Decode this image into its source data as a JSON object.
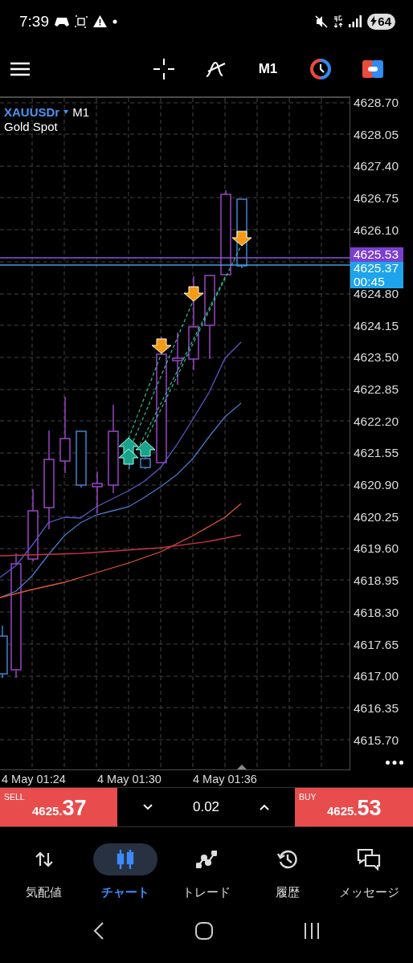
{
  "status_bar": {
    "time": "7:39",
    "battery": "64"
  },
  "toolbar": {
    "timeframe": "M1"
  },
  "chart": {
    "symbol": "XAUUSDr",
    "timeframe": "M1",
    "description": "Gold Spot",
    "price_axis": [
      {
        "kind": "tick",
        "label": "4628.70"
      },
      {
        "kind": "tick",
        "label": "4628.05"
      },
      {
        "kind": "tick",
        "label": "4627.40"
      },
      {
        "kind": "tick",
        "label": "4626.75"
      },
      {
        "kind": "tick",
        "label": "4626.10"
      },
      {
        "kind": "quote",
        "ask": "4625.53",
        "bid": "4625.37",
        "countdown": "00:45"
      },
      {
        "kind": "tick",
        "label": "4624.80"
      },
      {
        "kind": "tick",
        "label": "4624.15"
      },
      {
        "kind": "tick",
        "label": "4623.50"
      },
      {
        "kind": "tick",
        "label": "4622.85"
      },
      {
        "kind": "tick",
        "label": "4622.20"
      },
      {
        "kind": "tick",
        "label": "4621.55"
      },
      {
        "kind": "tick",
        "label": "4620.90"
      },
      {
        "kind": "tick",
        "label": "4620.25"
      },
      {
        "kind": "tick",
        "label": "4619.60"
      },
      {
        "kind": "tick",
        "label": "4618.95"
      },
      {
        "kind": "tick",
        "label": "4618.30"
      },
      {
        "kind": "tick",
        "label": "4617.65"
      },
      {
        "kind": "tick",
        "label": "4617.00"
      },
      {
        "kind": "tick",
        "label": "4616.35"
      },
      {
        "kind": "tick",
        "label": "4615.70"
      }
    ],
    "time_labels": [
      "4 May 01:24",
      "4 May 01:30",
      "4 May 01:36"
    ]
  },
  "trade_panel": {
    "sell": {
      "label": "SELL",
      "price_head": "4625.",
      "price_tail": "37"
    },
    "volume": "0.02",
    "buy": {
      "label": "BUY",
      "price_head": "4625.",
      "price_tail": "53"
    }
  },
  "nav": [
    {
      "kind": "quotes",
      "label": "気配値",
      "selected": false
    },
    {
      "kind": "chart",
      "label": "チャート",
      "selected": true
    },
    {
      "kind": "trade",
      "label": "トレード",
      "selected": false
    },
    {
      "kind": "history",
      "label": "履歴",
      "selected": false
    },
    {
      "kind": "messages",
      "label": "メッセージ",
      "selected": false
    }
  ]
}
